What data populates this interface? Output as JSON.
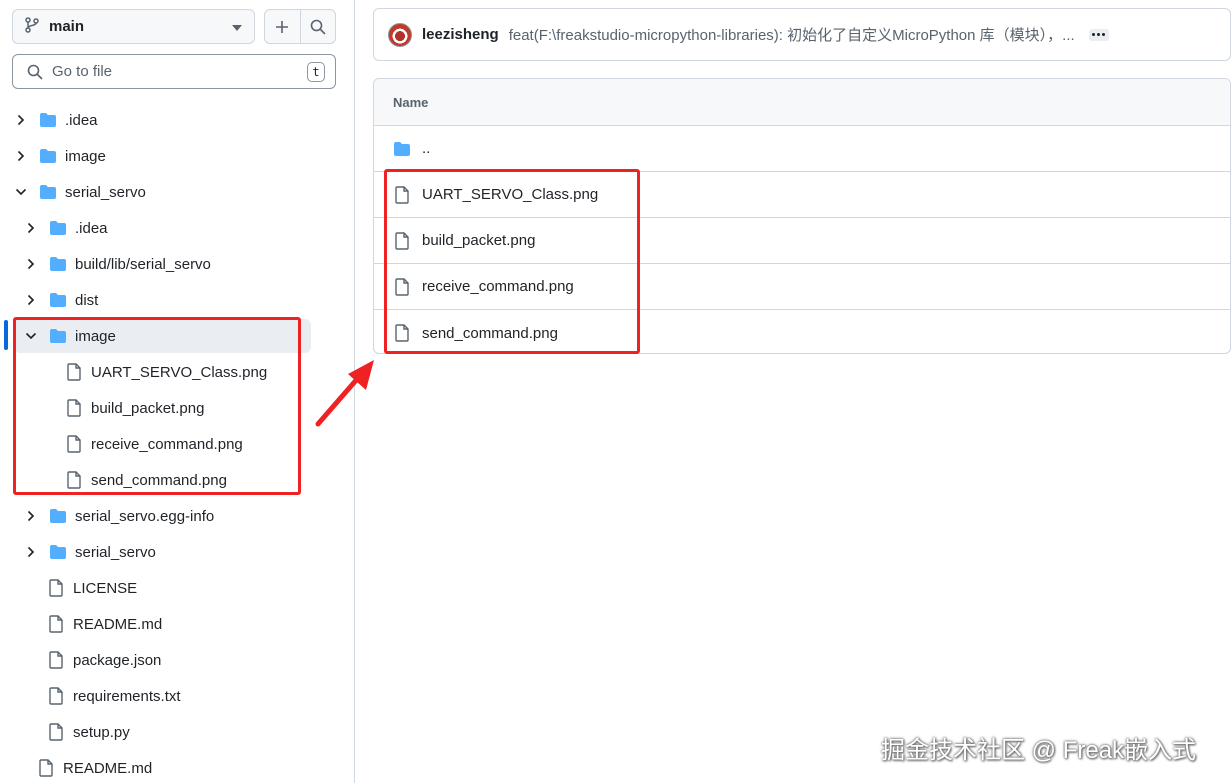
{
  "sidebar": {
    "branch": "main",
    "search_placeholder": "Go to file",
    "search_shortcut": "t",
    "tree": [
      {
        "label": ".idea",
        "type": "folder",
        "chevron": "right"
      },
      {
        "label": "image",
        "type": "folder",
        "chevron": "right"
      },
      {
        "label": "serial_servo",
        "type": "folder",
        "chevron": "down"
      },
      {
        "label": ".idea",
        "type": "folder",
        "chevron": "right"
      },
      {
        "label": "build/lib/serial_servo",
        "type": "folder",
        "chevron": "right"
      },
      {
        "label": "dist",
        "type": "folder",
        "chevron": "right"
      },
      {
        "label": "image",
        "type": "folder",
        "chevron": "down"
      },
      {
        "label": "UART_SERVO_Class.png",
        "type": "file"
      },
      {
        "label": "build_packet.png",
        "type": "file"
      },
      {
        "label": "receive_command.png",
        "type": "file"
      },
      {
        "label": "send_command.png",
        "type": "file"
      },
      {
        "label": "serial_servo.egg-info",
        "type": "folder",
        "chevron": "right"
      },
      {
        "label": "serial_servo",
        "type": "folder",
        "chevron": "right"
      },
      {
        "label": "LICENSE",
        "type": "file"
      },
      {
        "label": "README.md",
        "type": "file"
      },
      {
        "label": "package.json",
        "type": "file"
      },
      {
        "label": "requirements.txt",
        "type": "file"
      },
      {
        "label": "setup.py",
        "type": "file"
      },
      {
        "label": "README.md",
        "type": "file"
      }
    ]
  },
  "commit": {
    "author": "leezisheng",
    "message": "feat(F:\\freakstudio-micropython-libraries): 初始化了自定义MicroPython 库（模块），..."
  },
  "table": {
    "header": "Name",
    "rows": [
      {
        "label": "..",
        "type": "folder"
      },
      {
        "label": "UART_SERVO_Class.png",
        "type": "file"
      },
      {
        "label": "build_packet.png",
        "type": "file"
      },
      {
        "label": "receive_command.png",
        "type": "file"
      },
      {
        "label": "send_command.png",
        "type": "file"
      }
    ]
  },
  "watermark": "掘金技术社区 @ Freak嵌入式",
  "colors": {
    "folder": "#54aeff",
    "annotation": "#ee2222",
    "accent": "#0969da"
  }
}
